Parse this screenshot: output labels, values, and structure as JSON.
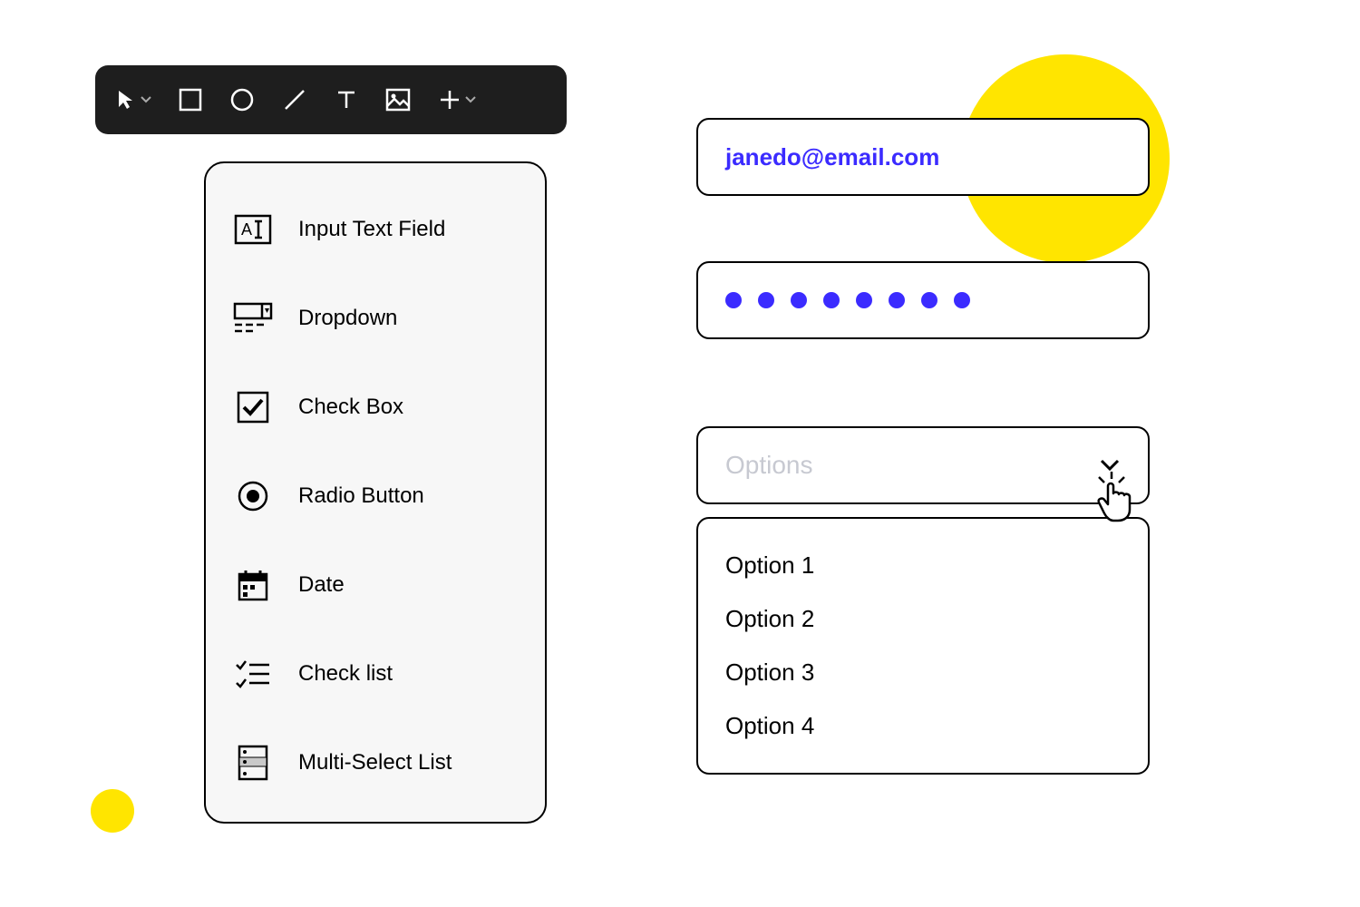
{
  "toolbar": {
    "items": [
      {
        "icon": "cursor",
        "has_caret": true
      },
      {
        "icon": "square"
      },
      {
        "icon": "circle"
      },
      {
        "icon": "line"
      },
      {
        "icon": "text"
      },
      {
        "icon": "image"
      },
      {
        "icon": "plus",
        "has_caret": true
      }
    ]
  },
  "palette": {
    "items": [
      {
        "label": "Input Text Field",
        "icon": "input-text"
      },
      {
        "label": "Dropdown",
        "icon": "dropdown"
      },
      {
        "label": "Check Box",
        "icon": "checkbox"
      },
      {
        "label": "Radio Button",
        "icon": "radio"
      },
      {
        "label": "Date",
        "icon": "date"
      },
      {
        "label": "Check list",
        "icon": "checklist"
      },
      {
        "label": "Multi-Select List",
        "icon": "multiselect"
      }
    ]
  },
  "form": {
    "email_value": "janedo@email.com",
    "password_dots": 8,
    "select": {
      "placeholder": "Options",
      "options": [
        "Option 1",
        "Option 2",
        "Option 3",
        "Option 4"
      ]
    }
  },
  "colors": {
    "accent": "#3B2BFF",
    "highlight": "#FFE500"
  }
}
